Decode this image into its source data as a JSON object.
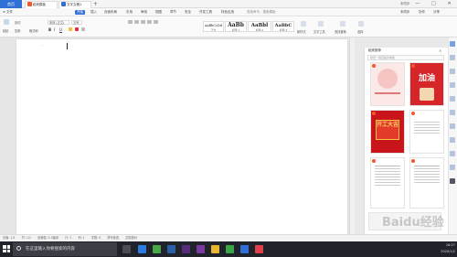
{
  "titlebar": {
    "home_tab": "首页",
    "tabs": [
      {
        "label": "稻壳模板"
      },
      {
        "label": "文字文稿1"
      }
    ],
    "new_tab": "+",
    "right_label": "未同步",
    "controls": [
      "—",
      "□",
      "✕"
    ]
  },
  "menubar": {
    "file": "≡ 文件",
    "items": [
      "开始",
      "插入",
      "页面布局",
      "引用",
      "审阅",
      "视图",
      "章节",
      "安全",
      "开发工具",
      "特色应用"
    ],
    "active": "开始",
    "search": "查找命令、搜索模板",
    "right": [
      "未同步",
      "协作",
      "分享"
    ]
  },
  "ribbon": {
    "paste": "粘贴",
    "cut": "剪切",
    "copy": "复制",
    "format_painter": "格式刷",
    "font_name": "宋体 (正文)",
    "font_size": "五号",
    "bold": "B",
    "italic": "I",
    "underline": "U",
    "styles": [
      {
        "sample": "AaBbCcDd",
        "name": "正文"
      },
      {
        "sample": "AaBb",
        "name": "标题 1"
      },
      {
        "sample": "AaBbl",
        "name": "标题 2"
      },
      {
        "sample": "AaBbC",
        "name": "标题 3"
      }
    ],
    "new_style": "新样式",
    "text_tool": "文字工具",
    "find_replace": "查找替换",
    "select": "选择"
  },
  "panel": {
    "title": "稻壳推荐",
    "search_placeholder": "搜索一招定稻壳模板",
    "cards": [
      {
        "text": "",
        "bg": "#fbe9e8"
      },
      {
        "text": "加油",
        "bg": "#d6262a"
      },
      {
        "text": "开工大吉",
        "bg": "#c8141a"
      },
      {
        "text": "",
        "bg": "#ffffff"
      },
      {
        "text": "",
        "bg": "#ffffff"
      },
      {
        "text": "",
        "bg": "#ffffff"
      }
    ]
  },
  "statusbar": {
    "page": "页面: 1/1",
    "section": "节: 1/1",
    "setting": "设置值: 2.5厘米",
    "row": "行: 1",
    "col": "列: 1",
    "words": "字数: 0",
    "spell": "拼写检查",
    "doc_check": "文档校对"
  },
  "taskbar": {
    "search_placeholder": "在这里输入你要搜索的内容",
    "time": "16:27",
    "date": "2020/1/2"
  },
  "watermark": "Baidu经验",
  "colors": {
    "accent": "#2f6fd6",
    "taskbar": "#20242a"
  }
}
